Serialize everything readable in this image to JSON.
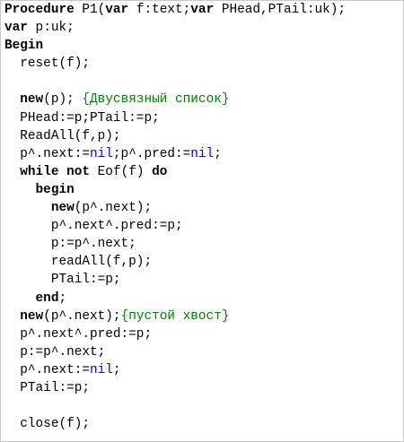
{
  "colors": {
    "keyword": "#000000",
    "nil": "#0000FF",
    "comment": "#008000",
    "text": "#000000",
    "background": "#FFFFFF"
  },
  "code": {
    "lines": [
      [
        {
          "t": "Procedure",
          "k": "kw"
        },
        {
          "t": " P1(",
          "k": ""
        },
        {
          "t": "var",
          "k": "kw"
        },
        {
          "t": " f:text;",
          "k": ""
        },
        {
          "t": "var",
          "k": "kw"
        },
        {
          "t": " PHead,PTail:uk);",
          "k": ""
        }
      ],
      [
        {
          "t": "var",
          "k": "kw"
        },
        {
          "t": " p:uk;",
          "k": ""
        }
      ],
      [
        {
          "t": "Begin",
          "k": "kw"
        }
      ],
      [
        {
          "t": "  reset(f);",
          "k": ""
        }
      ],
      [
        {
          "t": "",
          "k": ""
        }
      ],
      [
        {
          "t": "  ",
          "k": ""
        },
        {
          "t": "new",
          "k": "kw"
        },
        {
          "t": "(p); ",
          "k": ""
        },
        {
          "t": "{Двусвязный список}",
          "k": "cmt"
        }
      ],
      [
        {
          "t": "  PHead:=p;PTail:=p;",
          "k": ""
        }
      ],
      [
        {
          "t": "  ReadAll(f,p);",
          "k": ""
        }
      ],
      [
        {
          "t": "  p^.next:=",
          "k": ""
        },
        {
          "t": "nil",
          "k": "nil"
        },
        {
          "t": ";p^.pred:=",
          "k": ""
        },
        {
          "t": "nil",
          "k": "nil"
        },
        {
          "t": ";",
          "k": ""
        }
      ],
      [
        {
          "t": "  ",
          "k": ""
        },
        {
          "t": "while",
          "k": "kw"
        },
        {
          "t": " ",
          "k": ""
        },
        {
          "t": "not",
          "k": "kw"
        },
        {
          "t": " Eof(f) ",
          "k": ""
        },
        {
          "t": "do",
          "k": "kw"
        }
      ],
      [
        {
          "t": "    ",
          "k": ""
        },
        {
          "t": "begin",
          "k": "kw"
        }
      ],
      [
        {
          "t": "      ",
          "k": ""
        },
        {
          "t": "new",
          "k": "kw"
        },
        {
          "t": "(p^.next);",
          "k": ""
        }
      ],
      [
        {
          "t": "      p^.next^.pred:=p;",
          "k": ""
        }
      ],
      [
        {
          "t": "      p:=p^.next;",
          "k": ""
        }
      ],
      [
        {
          "t": "      readAll(f,p);",
          "k": ""
        }
      ],
      [
        {
          "t": "      PTail:=p;",
          "k": ""
        }
      ],
      [
        {
          "t": "    ",
          "k": ""
        },
        {
          "t": "end",
          "k": "kw"
        },
        {
          "t": ";",
          "k": ""
        }
      ],
      [
        {
          "t": "  ",
          "k": ""
        },
        {
          "t": "new",
          "k": "kw"
        },
        {
          "t": "(p^.next);",
          "k": ""
        },
        {
          "t": "{пустой хвост}",
          "k": "cmt"
        }
      ],
      [
        {
          "t": "  p^.next^.pred:=p;",
          "k": ""
        }
      ],
      [
        {
          "t": "  p:=p^.next;",
          "k": ""
        }
      ],
      [
        {
          "t": "  p^.next:=",
          "k": ""
        },
        {
          "t": "nil",
          "k": "nil"
        },
        {
          "t": ";",
          "k": ""
        }
      ],
      [
        {
          "t": "  PTail:=p;",
          "k": ""
        }
      ],
      [
        {
          "t": "",
          "k": ""
        }
      ],
      [
        {
          "t": "  close(f);",
          "k": ""
        }
      ]
    ]
  }
}
